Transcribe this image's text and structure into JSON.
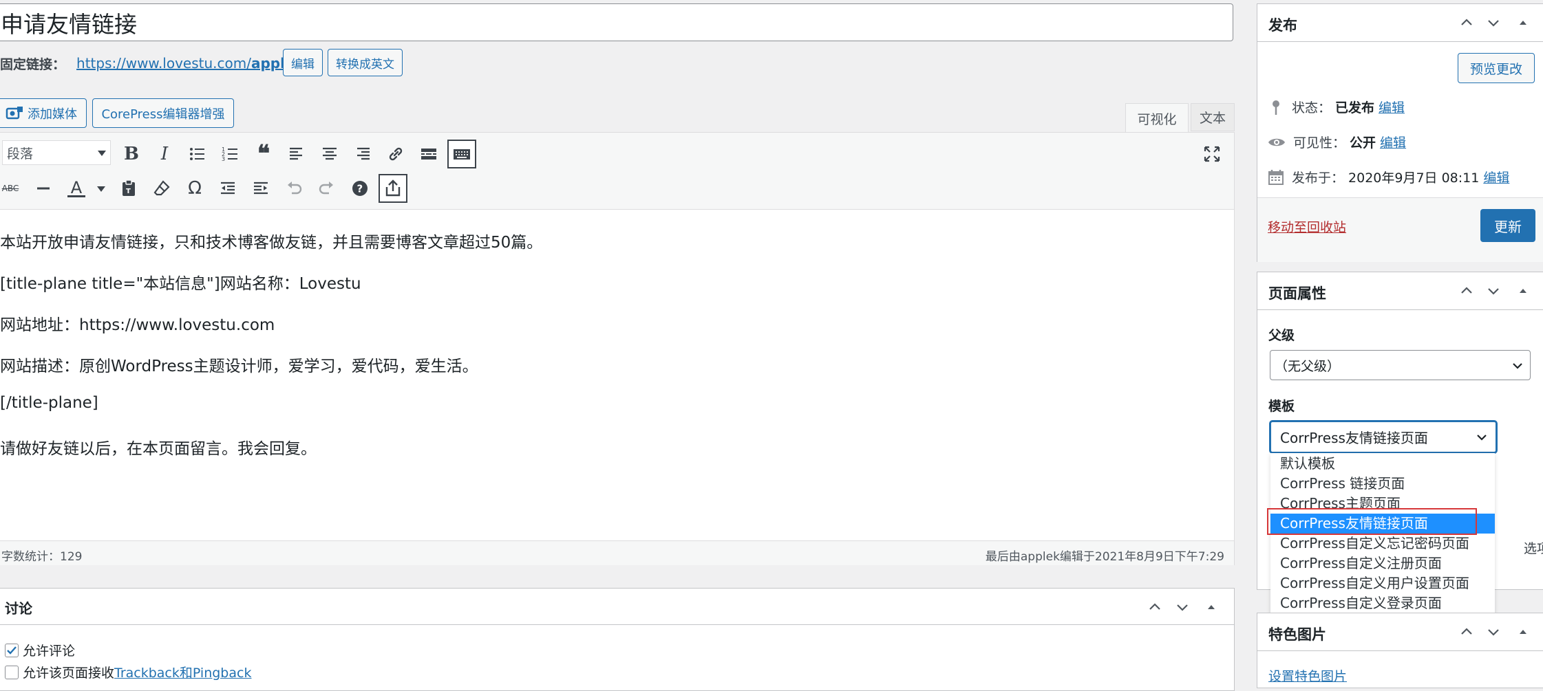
{
  "title": "申请友情链接",
  "permalink": {
    "label": "固定链接：",
    "url_base": "https://www.lovestu.com/",
    "url_slug": "applylink",
    "edit": "编辑",
    "convert": "转换成英文"
  },
  "media": {
    "add_media": "添加媒体",
    "corepress": "CorePress编辑器增强"
  },
  "editor_tabs": {
    "visual": "可视化",
    "text": "文本"
  },
  "format_select": "段落",
  "content": [
    "本站开放申请友情链接，只和技术博客做友链，并且需要博客文章超过50篇。",
    "[title-plane title=\"本站信息\"]网站名称：Lovestu",
    "网站地址：https://www.lovestu.com",
    "网站描述：原创WordPress主题设计师，爱学习，爱代码，爱生活。",
    "[/title-plane]",
    "请做好友链以后，在本页面留言。我会回复。"
  ],
  "status_bar": {
    "word_count": "字数统计：129",
    "last_edit": "最后由applek编辑于2021年8月9日下午7:29"
  },
  "discussion": {
    "title": "讨论",
    "allow_comments": "允许评论",
    "allow_pings_prefix": "允许该页面接收",
    "allow_pings_link": "Trackback和Pingback"
  },
  "publish": {
    "title": "发布",
    "preview": "预览更改",
    "status_label": "状态：",
    "status_value": "已发布",
    "status_edit": "编辑",
    "visibility_label": "可见性：",
    "visibility_value": "公开",
    "visibility_edit": "编辑",
    "date_label": "发布于：",
    "date_value": "2020年9月7日 08:11",
    "date_edit": "编辑",
    "trash": "移动至回收站",
    "update": "更新"
  },
  "page_attributes": {
    "title": "页面属性",
    "parent_label": "父级",
    "parent_value": "（无父级）",
    "template_label": "模板",
    "template_value": "CorrPress友情链接页面",
    "template_options": [
      "默认模板",
      "CorrPress 链接页面",
      "CorrPress主题页面",
      "CorrPress友情链接页面",
      "CorrPress自定义忘记密码页面",
      "CorrPress自定义注册页面",
      "CorrPress自定义用户设置页面",
      "CorrPress自定义登录页面"
    ],
    "selected_index": 3,
    "hidden_suffix": "选项"
  },
  "featured_image": {
    "title": "特色图片",
    "set_link": "设置特色图片"
  },
  "colors": {
    "accent": "#2271b1",
    "selected": "#1e90ff",
    "highlight_border": "#d63638"
  }
}
